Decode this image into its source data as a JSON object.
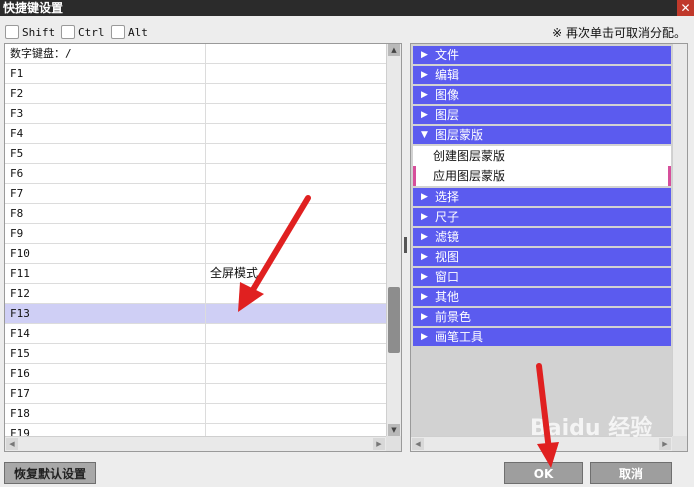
{
  "window": {
    "title": "快捷键设置",
    "close_glyph": "✕"
  },
  "modifiers": [
    {
      "label": "Shift",
      "checked": false
    },
    {
      "label": "Ctrl",
      "checked": false
    },
    {
      "label": "Alt",
      "checked": false
    }
  ],
  "hint": "※ 再次单击可取消分配。",
  "key_table": {
    "rows": [
      {
        "key": "数字键盘：/",
        "function": ""
      },
      {
        "key": "F1",
        "function": ""
      },
      {
        "key": "F2",
        "function": ""
      },
      {
        "key": "F3",
        "function": ""
      },
      {
        "key": "F4",
        "function": ""
      },
      {
        "key": "F5",
        "function": ""
      },
      {
        "key": "F6",
        "function": ""
      },
      {
        "key": "F7",
        "function": ""
      },
      {
        "key": "F8",
        "function": ""
      },
      {
        "key": "F9",
        "function": ""
      },
      {
        "key": "F10",
        "function": ""
      },
      {
        "key": "F11",
        "function": "全屏模式"
      },
      {
        "key": "F12",
        "function": ""
      },
      {
        "key": "F13",
        "function": ""
      },
      {
        "key": "F14",
        "function": ""
      },
      {
        "key": "F15",
        "function": ""
      },
      {
        "key": "F16",
        "function": ""
      },
      {
        "key": "F17",
        "function": ""
      },
      {
        "key": "F18",
        "function": ""
      },
      {
        "key": "F19",
        "function": ""
      }
    ],
    "selected_row": 13
  },
  "categories": [
    {
      "label": "文件",
      "expanded": false
    },
    {
      "label": "编辑",
      "expanded": false
    },
    {
      "label": "图像",
      "expanded": false
    },
    {
      "label": "图层",
      "expanded": false
    },
    {
      "label": "图层蒙版",
      "expanded": true,
      "items": [
        "创建图层蒙版",
        "应用图层蒙版"
      ]
    },
    {
      "label": "选择",
      "expanded": false
    },
    {
      "label": "尺子",
      "expanded": false
    },
    {
      "label": "滤镜",
      "expanded": false
    },
    {
      "label": "视图",
      "expanded": false
    },
    {
      "label": "窗口",
      "expanded": false
    },
    {
      "label": "其他",
      "expanded": false
    },
    {
      "label": "前景色",
      "expanded": false
    },
    {
      "label": "画笔工具",
      "expanded": false
    }
  ],
  "buttons": {
    "reset": "恢复默认设置",
    "ok": "OK",
    "cancel": "取消"
  },
  "watermark": "Baidu 经验",
  "colors": {
    "category_bg": "#5b5bef",
    "selected_row": "#cfcff5",
    "arrow": "#e02020",
    "marker": "#d64f9b"
  },
  "icons": {
    "collapsed": "triangle-right-icon",
    "expanded": "triangle-down-icon",
    "close": "close-icon"
  }
}
